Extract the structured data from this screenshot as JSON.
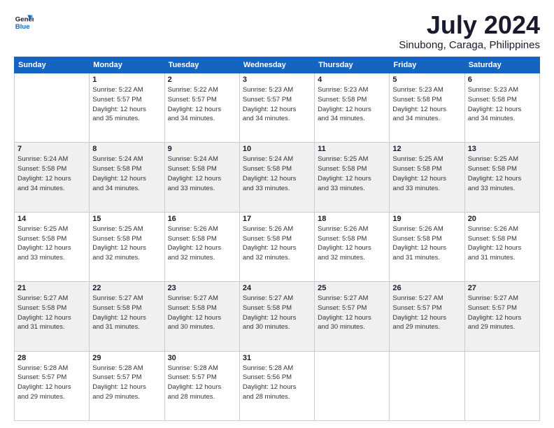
{
  "header": {
    "logo_line1": "General",
    "logo_line2": "Blue",
    "month": "July 2024",
    "location": "Sinubong, Caraga, Philippines"
  },
  "days_of_week": [
    "Sunday",
    "Monday",
    "Tuesday",
    "Wednesday",
    "Thursday",
    "Friday",
    "Saturday"
  ],
  "weeks": [
    [
      {
        "day": "",
        "info": ""
      },
      {
        "day": "1",
        "info": "Sunrise: 5:22 AM\nSunset: 5:57 PM\nDaylight: 12 hours\nand 35 minutes."
      },
      {
        "day": "2",
        "info": "Sunrise: 5:22 AM\nSunset: 5:57 PM\nDaylight: 12 hours\nand 34 minutes."
      },
      {
        "day": "3",
        "info": "Sunrise: 5:23 AM\nSunset: 5:57 PM\nDaylight: 12 hours\nand 34 minutes."
      },
      {
        "day": "4",
        "info": "Sunrise: 5:23 AM\nSunset: 5:58 PM\nDaylight: 12 hours\nand 34 minutes."
      },
      {
        "day": "5",
        "info": "Sunrise: 5:23 AM\nSunset: 5:58 PM\nDaylight: 12 hours\nand 34 minutes."
      },
      {
        "day": "6",
        "info": "Sunrise: 5:23 AM\nSunset: 5:58 PM\nDaylight: 12 hours\nand 34 minutes."
      }
    ],
    [
      {
        "day": "7",
        "info": "Sunrise: 5:24 AM\nSunset: 5:58 PM\nDaylight: 12 hours\nand 34 minutes."
      },
      {
        "day": "8",
        "info": "Sunrise: 5:24 AM\nSunset: 5:58 PM\nDaylight: 12 hours\nand 34 minutes."
      },
      {
        "day": "9",
        "info": "Sunrise: 5:24 AM\nSunset: 5:58 PM\nDaylight: 12 hours\nand 33 minutes."
      },
      {
        "day": "10",
        "info": "Sunrise: 5:24 AM\nSunset: 5:58 PM\nDaylight: 12 hours\nand 33 minutes."
      },
      {
        "day": "11",
        "info": "Sunrise: 5:25 AM\nSunset: 5:58 PM\nDaylight: 12 hours\nand 33 minutes."
      },
      {
        "day": "12",
        "info": "Sunrise: 5:25 AM\nSunset: 5:58 PM\nDaylight: 12 hours\nand 33 minutes."
      },
      {
        "day": "13",
        "info": "Sunrise: 5:25 AM\nSunset: 5:58 PM\nDaylight: 12 hours\nand 33 minutes."
      }
    ],
    [
      {
        "day": "14",
        "info": "Sunrise: 5:25 AM\nSunset: 5:58 PM\nDaylight: 12 hours\nand 33 minutes."
      },
      {
        "day": "15",
        "info": "Sunrise: 5:25 AM\nSunset: 5:58 PM\nDaylight: 12 hours\nand 32 minutes."
      },
      {
        "day": "16",
        "info": "Sunrise: 5:26 AM\nSunset: 5:58 PM\nDaylight: 12 hours\nand 32 minutes."
      },
      {
        "day": "17",
        "info": "Sunrise: 5:26 AM\nSunset: 5:58 PM\nDaylight: 12 hours\nand 32 minutes."
      },
      {
        "day": "18",
        "info": "Sunrise: 5:26 AM\nSunset: 5:58 PM\nDaylight: 12 hours\nand 32 minutes."
      },
      {
        "day": "19",
        "info": "Sunrise: 5:26 AM\nSunset: 5:58 PM\nDaylight: 12 hours\nand 31 minutes."
      },
      {
        "day": "20",
        "info": "Sunrise: 5:26 AM\nSunset: 5:58 PM\nDaylight: 12 hours\nand 31 minutes."
      }
    ],
    [
      {
        "day": "21",
        "info": "Sunrise: 5:27 AM\nSunset: 5:58 PM\nDaylight: 12 hours\nand 31 minutes."
      },
      {
        "day": "22",
        "info": "Sunrise: 5:27 AM\nSunset: 5:58 PM\nDaylight: 12 hours\nand 31 minutes."
      },
      {
        "day": "23",
        "info": "Sunrise: 5:27 AM\nSunset: 5:58 PM\nDaylight: 12 hours\nand 30 minutes."
      },
      {
        "day": "24",
        "info": "Sunrise: 5:27 AM\nSunset: 5:58 PM\nDaylight: 12 hours\nand 30 minutes."
      },
      {
        "day": "25",
        "info": "Sunrise: 5:27 AM\nSunset: 5:57 PM\nDaylight: 12 hours\nand 30 minutes."
      },
      {
        "day": "26",
        "info": "Sunrise: 5:27 AM\nSunset: 5:57 PM\nDaylight: 12 hours\nand 29 minutes."
      },
      {
        "day": "27",
        "info": "Sunrise: 5:27 AM\nSunset: 5:57 PM\nDaylight: 12 hours\nand 29 minutes."
      }
    ],
    [
      {
        "day": "28",
        "info": "Sunrise: 5:28 AM\nSunset: 5:57 PM\nDaylight: 12 hours\nand 29 minutes."
      },
      {
        "day": "29",
        "info": "Sunrise: 5:28 AM\nSunset: 5:57 PM\nDaylight: 12 hours\nand 29 minutes."
      },
      {
        "day": "30",
        "info": "Sunrise: 5:28 AM\nSunset: 5:57 PM\nDaylight: 12 hours\nand 28 minutes."
      },
      {
        "day": "31",
        "info": "Sunrise: 5:28 AM\nSunset: 5:56 PM\nDaylight: 12 hours\nand 28 minutes."
      },
      {
        "day": "",
        "info": ""
      },
      {
        "day": "",
        "info": ""
      },
      {
        "day": "",
        "info": ""
      }
    ]
  ]
}
